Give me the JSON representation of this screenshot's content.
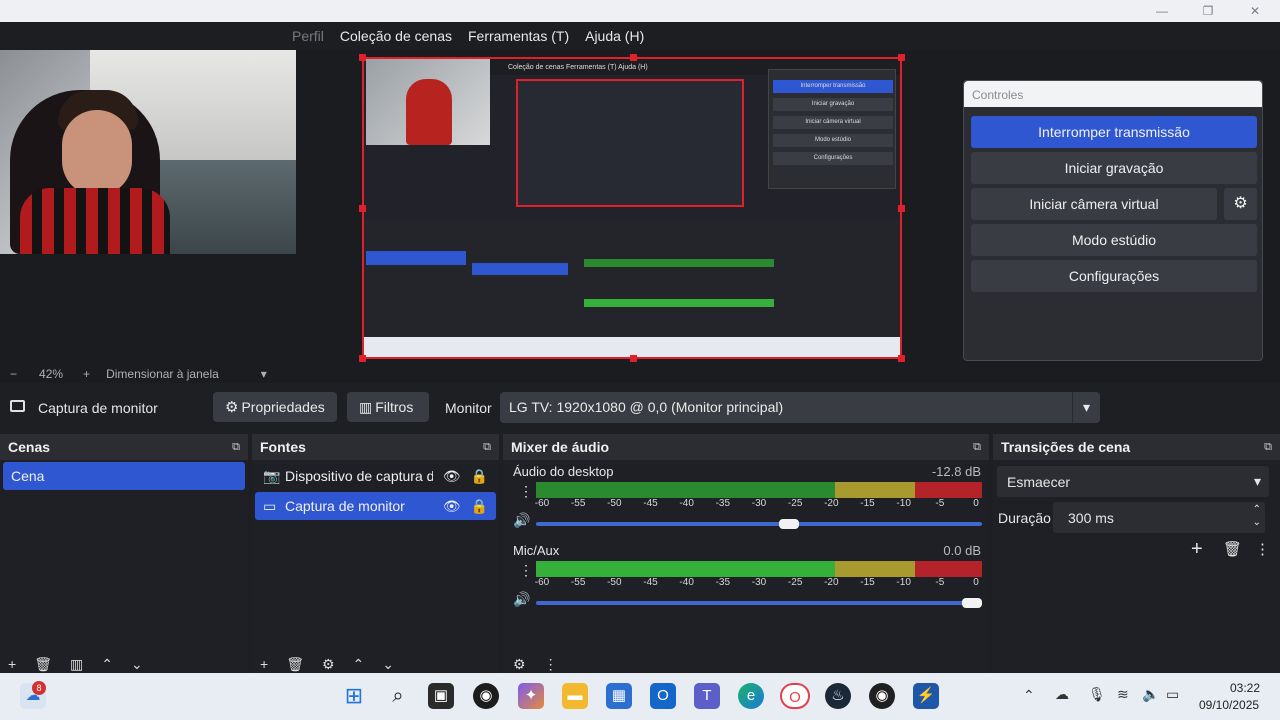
{
  "menu": {
    "partial_left": "Perfil",
    "items": [
      "Coleção de cenas",
      "Ferramentas (T)",
      "Ajuda (H)"
    ]
  },
  "zoom": {
    "minus": "−",
    "percent": "42%",
    "plus": "+",
    "fit_label": "Dimensionar à janela",
    "arrow": "▾"
  },
  "source_bar": {
    "selected_source": "Captura de monitor",
    "properties_label": "Propriedades",
    "filters_label": "Filtros",
    "monitor_label": "Monitor",
    "monitor_value": "LG TV: 1920x1080 @ 0,0 (Monitor principal)"
  },
  "scenes": {
    "title": "Cenas",
    "items": [
      "Cena"
    ]
  },
  "sources": {
    "title": "Fontes",
    "items": [
      "Dispositivo de captura de",
      "Captura de monitor"
    ]
  },
  "mixer": {
    "title": "Mixer de áudio",
    "channels": [
      {
        "name": "Áudio do desktop",
        "db": "-12.8 dB",
        "level": 0.67,
        "volume": 0.59
      },
      {
        "name": "Mic/Aux",
        "db": "0.0 dB",
        "level": 0.68,
        "volume": 1.0
      }
    ],
    "ticks": [
      "-60",
      "-55",
      "-50",
      "-45",
      "-40",
      "-35",
      "-30",
      "-25",
      "-20",
      "-15",
      "-10",
      "-5",
      "0"
    ]
  },
  "transitions": {
    "title": "Transições de cena",
    "selected": "Esmaecer",
    "duration_label": "Duração",
    "duration_value": "300 ms"
  },
  "controls": {
    "title": "Controles",
    "buttons": [
      "Interromper transmissão",
      "Iniciar gravação",
      "Iniciar câmera virtual",
      "Modo estúdio",
      "Configurações"
    ]
  },
  "nested_preview": {
    "menu": "Coleção de cenas   Ferramentas (T)   Ajuda (H)",
    "buttons": [
      "Interromper transmissão",
      "Iniciar gravação",
      "Iniciar câmera virtual",
      "Modo estúdio",
      "Configurações"
    ]
  },
  "taskbar": {
    "weather_badge": "8",
    "time": "03:22",
    "date": "09/10/2025"
  },
  "colors": {
    "accent_blue": "#2f57d1",
    "stream_button": "#2f57d1",
    "preview_border": "#e0212b",
    "meter_green": "#35b03a",
    "meter_yellow": "#a89a2e",
    "meter_red": "#b4232a"
  }
}
